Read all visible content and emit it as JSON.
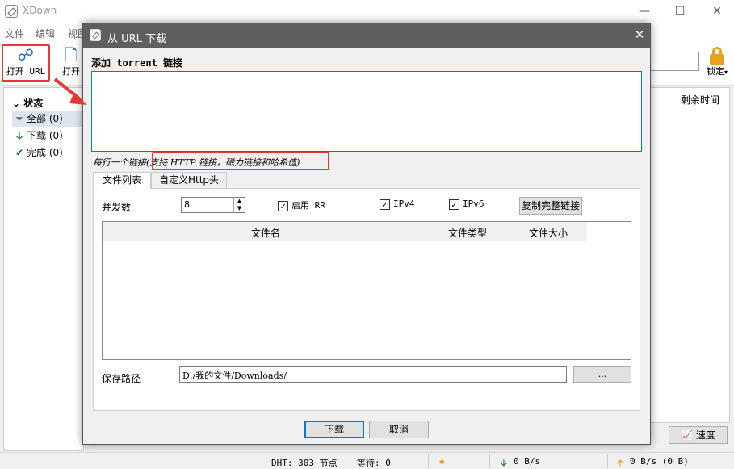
{
  "app": {
    "title": "XDown"
  },
  "menu": {
    "file": "文件",
    "edit": "编辑",
    "view": "视图"
  },
  "toolbar": {
    "open_url": "打开 URL",
    "open": "打开",
    "lock": "锁定"
  },
  "sidebar": {
    "header": "状态",
    "items": [
      {
        "label": "全部 (0)",
        "icon": "filter-icon"
      },
      {
        "label": "下载 (0)",
        "icon": "download-arrow-icon"
      },
      {
        "label": "完成 (0)",
        "icon": "check-icon"
      }
    ]
  },
  "list": {
    "col_remaining": "剩余时间"
  },
  "speed_button": "速度",
  "status": {
    "dht": "DHT: 303 节点",
    "waiting": "等待: 0",
    "down": "0 B/s",
    "up": "0 B/s (0 B)"
  },
  "dialog": {
    "title": "从 URL 下载",
    "add_label": "添加 torrent 链接",
    "url_value": "",
    "hint_prefix": "每行一个链接",
    "hint_highlight": "(支持 HTTP 链接，磁力链接和哈希值)",
    "tabs": [
      "文件列表",
      "自定义Http头"
    ],
    "concurrency_label": "并发数",
    "concurrency_value": "8",
    "enable_rr": "启用 RR",
    "ipv4": "IPv4",
    "ipv6": "IPv6",
    "copy_links": "复制完整链接",
    "columns": {
      "name": "文件名",
      "type": "文件类型",
      "size": "文件大小"
    },
    "save_path_label": "保存路径",
    "save_path": "D:/我的文件/Downloads/",
    "browse": "...",
    "download": "下载",
    "cancel": "取消"
  },
  "colors": {
    "highlight": "#e53935",
    "accent": "#0078d7",
    "dialog_title": "#5f5f5f"
  }
}
